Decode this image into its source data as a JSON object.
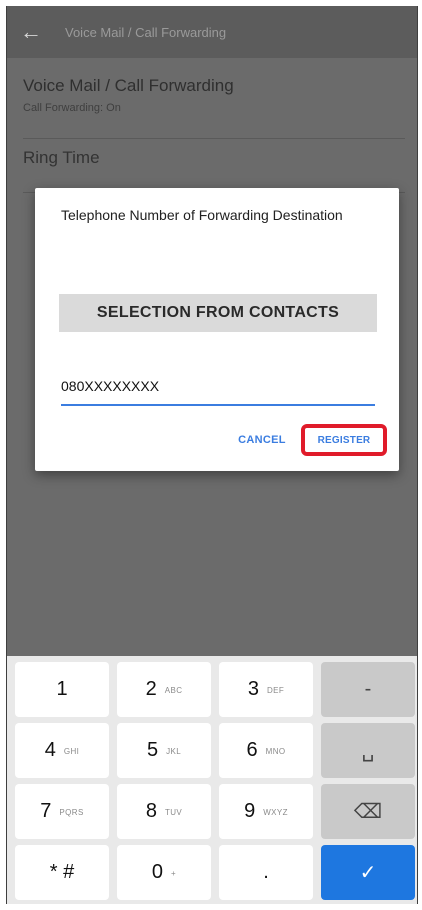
{
  "appbar": {
    "back_icon": "arrow-left",
    "title": "Voice Mail / Call Forwarding"
  },
  "settings": [
    {
      "title": "Voice Mail / Call Forwarding",
      "subtitle": "Call Forwarding: On"
    },
    {
      "title": "Ring Time"
    }
  ],
  "dialog": {
    "title": "Telephone Number of Forwarding Destination",
    "contacts_button": "SELECTION FROM CONTACTS",
    "phone_value": "080XXXXXXXX",
    "cancel": "CANCEL",
    "register": "REGISTER",
    "highlight_color": "#e01b2a",
    "accent_color": "#3b7de0"
  },
  "keypad": {
    "keys": [
      {
        "main": "1",
        "sub": ""
      },
      {
        "main": "2",
        "sub": "ABC"
      },
      {
        "main": "3",
        "sub": "DEF"
      },
      {
        "main": "-",
        "sub": ""
      },
      {
        "main": "4",
        "sub": "GHI"
      },
      {
        "main": "5",
        "sub": "JKL"
      },
      {
        "main": "6",
        "sub": "MNO"
      },
      {
        "main": "␣",
        "sub": ""
      },
      {
        "main": "7",
        "sub": "PQRS"
      },
      {
        "main": "8",
        "sub": "TUV"
      },
      {
        "main": "9",
        "sub": "WXYZ"
      },
      {
        "main": "⌫",
        "sub": ""
      },
      {
        "main": "* #",
        "sub": ""
      },
      {
        "main": "0",
        "sub": "+"
      },
      {
        "main": ".",
        "sub": ""
      },
      {
        "main": "✓",
        "sub": ""
      }
    ],
    "enter_color": "#1e77e0"
  }
}
